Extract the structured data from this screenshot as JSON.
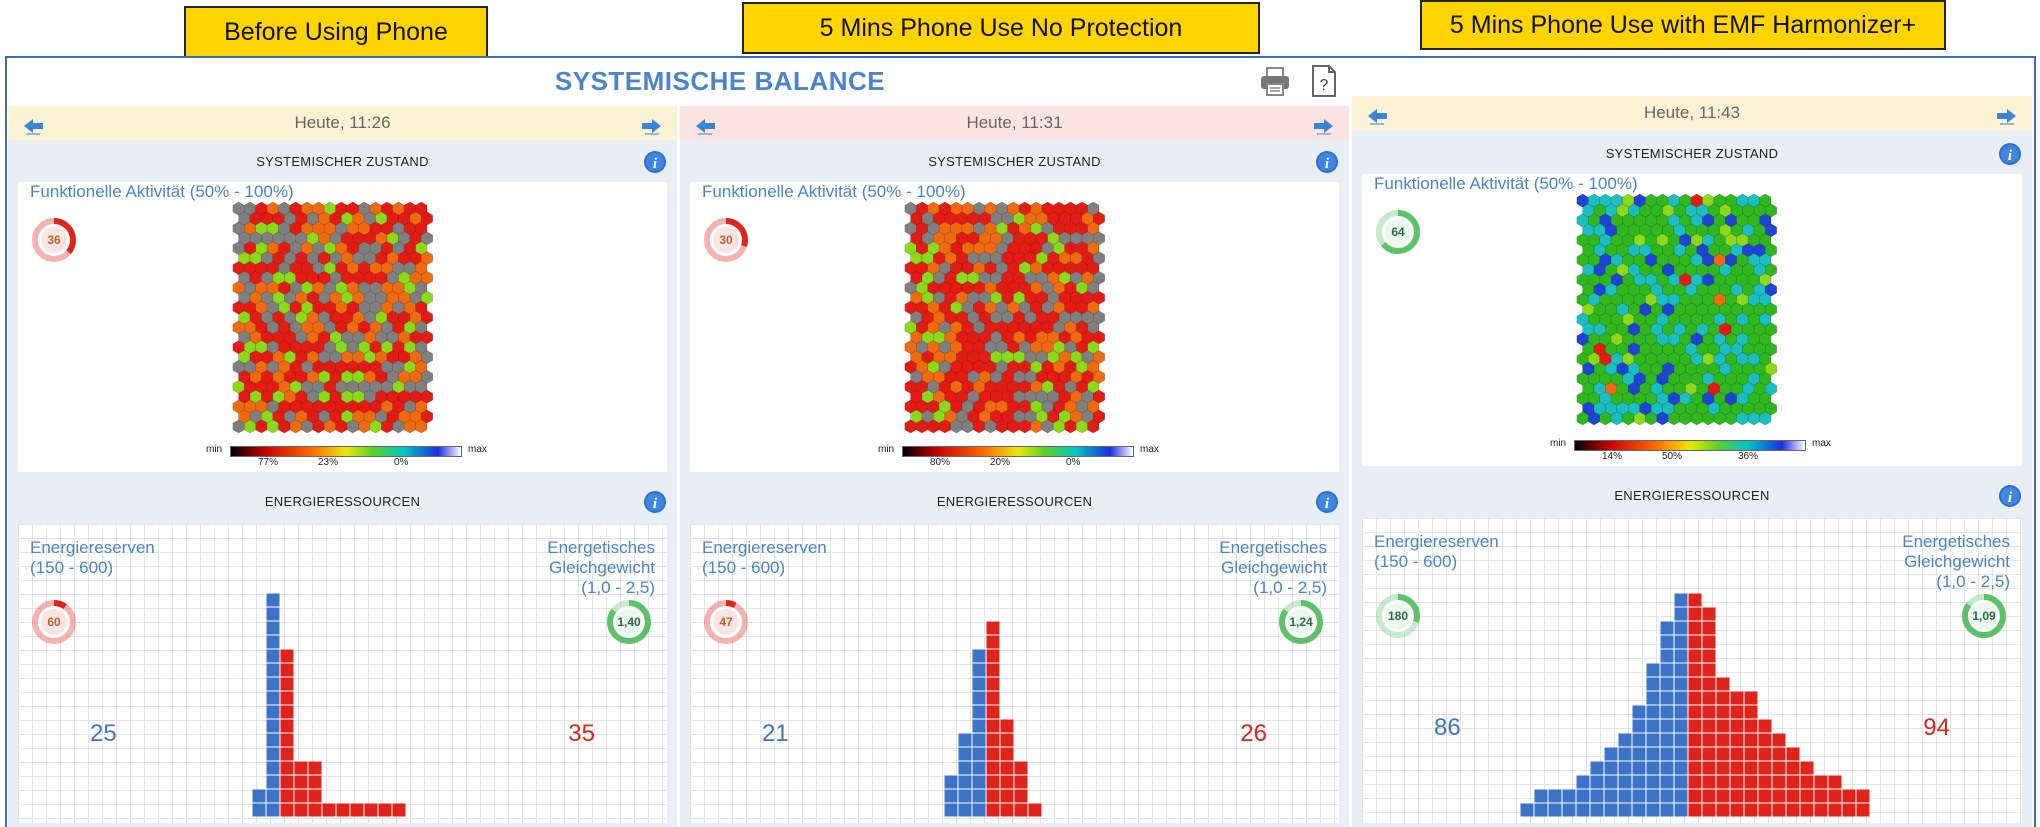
{
  "captions": [
    "Before Using Phone",
    "5 Mins Phone Use No Protection",
    "5 Mins Phone Use with EMF Harmonizer+"
  ],
  "app": {
    "title": "SYSTEMISCHE BALANCE",
    "print_icon": "printer-icon",
    "help_icon": "help-icon"
  },
  "colors": {
    "blue_text": "#4a85c8",
    "red": "#e0241b",
    "green_gauge": "#5cc26a",
    "caption_bg": "#ffd400"
  },
  "panels": [
    {
      "date": "Heute, 11:26",
      "nav_bg": "#faf2d3",
      "zustand": {
        "heading": "SYSTEMISCHER ZUSTAND",
        "activity_label": "Funktionelle Aktivität (50% - 100%)",
        "activity_value": "36",
        "activity_fraction": 0.36,
        "gauge_color": "#e0241b",
        "scale_min": "min",
        "scale_max": "max",
        "scale_labels": [
          "77%",
          "23%",
          "0%"
        ],
        "mix": [
          0.32,
          0.19,
          0.17,
          0.32,
          0.0,
          0.0,
          0.0
        ]
      },
      "energie": {
        "heading": "ENERGIERESSOURCEN",
        "reserves_label_1": "Energiereserven",
        "reserves_label_2": "(150 - 600)",
        "reserves_value": "60",
        "reserves_fraction": 0.1,
        "reserves_color": "#e0241b",
        "balance_label_1": "Energetisches",
        "balance_label_2": "Gleichgewicht",
        "balance_label_3": "(1,0 - 2,5)",
        "balance_value": "1,40",
        "balance_color": "#5cc26a",
        "left_count": "25",
        "right_count": "35",
        "blue_cols": [
          2,
          16
        ],
        "red_cols": [
          12,
          4,
          4,
          1,
          1,
          1,
          1,
          1,
          1
        ]
      }
    },
    {
      "date": "Heute, 11:31",
      "nav_bg": "#fde4e2",
      "zustand": {
        "heading": "SYSTEMISCHER ZUSTAND",
        "activity_label": "Funktionelle Aktivität (50% - 100%)",
        "activity_value": "30",
        "activity_fraction": 0.3,
        "gauge_color": "#e0241b",
        "scale_min": "min",
        "scale_max": "max",
        "scale_labels": [
          "80%",
          "20%",
          "0%"
        ],
        "mix": [
          0.4,
          0.2,
          0.12,
          0.28,
          0.0,
          0.0,
          0.0
        ]
      },
      "energie": {
        "heading": "ENERGIERESSOURCEN",
        "reserves_label_1": "Energiereserven",
        "reserves_label_2": "(150 - 600)",
        "reserves_value": "47",
        "reserves_fraction": 0.08,
        "reserves_color": "#e0241b",
        "balance_label_1": "Energetisches",
        "balance_label_2": "Gleichgewicht",
        "balance_label_3": "(1,0 - 2,5)",
        "balance_value": "1,24",
        "balance_color": "#5cc26a",
        "left_count": "21",
        "right_count": "26",
        "blue_cols": [
          3,
          6,
          12
        ],
        "red_cols": [
          14,
          7,
          4,
          1
        ]
      }
    },
    {
      "date": "Heute, 11:43",
      "nav_bg": "#faf2d3",
      "zustand": {
        "heading": "SYSTEMISCHER ZUSTAND",
        "activity_label": "Funktionelle Aktivität (50% - 100%)",
        "activity_value": "64",
        "activity_fraction": 0.64,
        "gauge_color": "#5cc26a",
        "scale_min": "min",
        "scale_max": "max",
        "scale_labels": [
          "14%",
          "50%",
          "36%"
        ],
        "mix": [
          0.02,
          0.02,
          0.08,
          0.0,
          0.55,
          0.22,
          0.11
        ]
      },
      "energie": {
        "heading": "ENERGIERESSOURCEN",
        "reserves_label_1": "Energiereserven",
        "reserves_label_2": "(150 - 600)",
        "reserves_value": "180",
        "reserves_fraction": 0.3,
        "reserves_color": "#5cc26a",
        "balance_label_1": "Energetisches",
        "balance_label_2": "Gleichgewicht",
        "balance_label_3": "(1,0 - 2,5)",
        "balance_value": "1,09",
        "balance_color": "#5cc26a",
        "left_count": "86",
        "right_count": "94",
        "blue_cols": [
          1,
          2,
          2,
          2,
          3,
          4,
          5,
          6,
          8,
          11,
          14,
          16
        ],
        "red_cols": [
          16,
          15,
          10,
          9,
          9,
          7,
          6,
          5,
          4,
          3,
          3,
          2,
          2
        ]
      }
    }
  ]
}
